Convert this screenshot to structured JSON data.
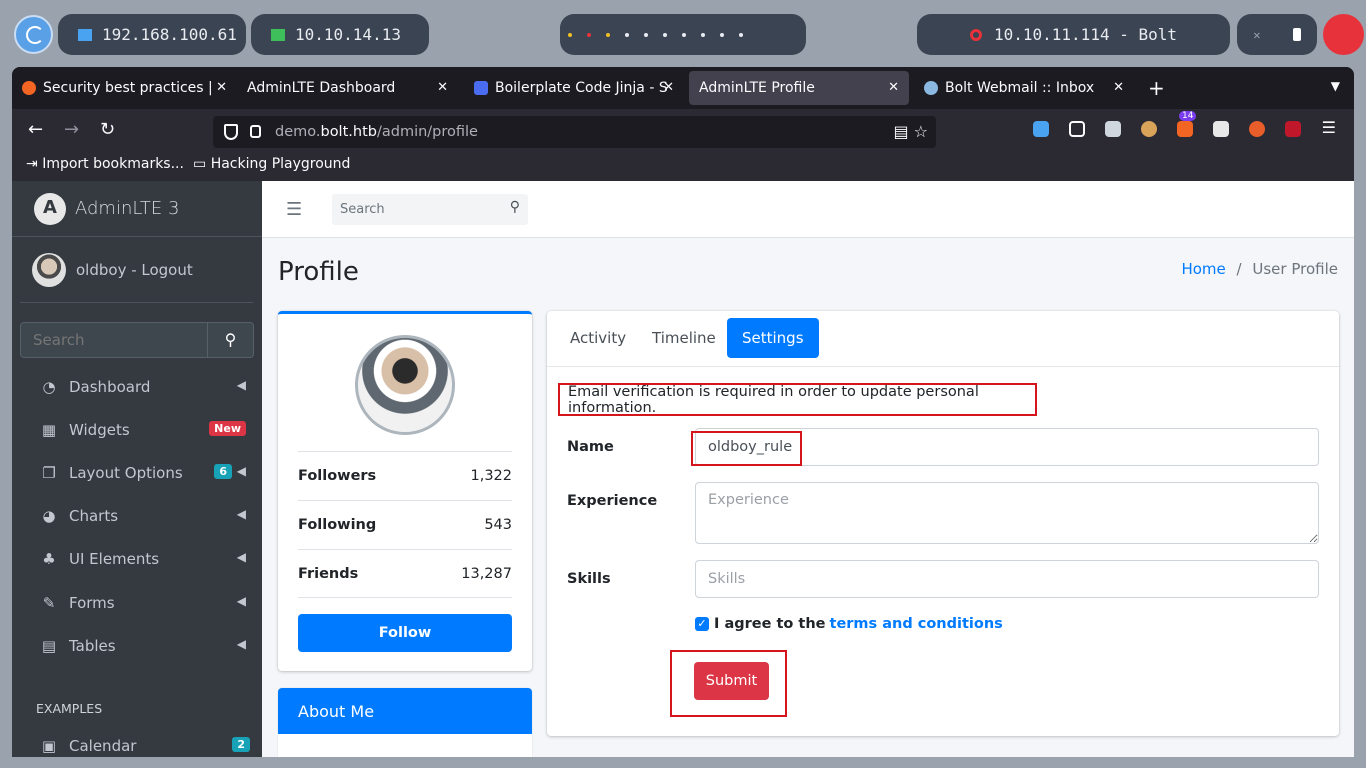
{
  "system_bar": {
    "ip_local": "192.168.100.61",
    "ip_vpn": "10.10.14.13",
    "target": "10.10.11.114 - Bolt"
  },
  "browser": {
    "tabs": [
      {
        "label": "Security best practices |"
      },
      {
        "label": "AdminLTE Dashboard"
      },
      {
        "label": "Boilerplate Code Jinja - S"
      },
      {
        "label": "AdminLTE Profile"
      },
      {
        "label": "Bolt Webmail :: Inbox"
      }
    ],
    "url_host_prefix": "demo.",
    "url_host_main": "bolt.htb",
    "url_path": "/admin/profile",
    "ext_badge": "14",
    "bookmarks": [
      {
        "label": "Import bookmarks..."
      },
      {
        "label": "Hacking Playground"
      }
    ]
  },
  "sidebar": {
    "brand": "AdminLTE 3",
    "user": "oldboy - Logout",
    "search_placeholder": "Search",
    "items": [
      {
        "label": "Dashboard"
      },
      {
        "label": "Widgets",
        "badge": "New"
      },
      {
        "label": "Layout Options",
        "badge": "6"
      },
      {
        "label": "Charts"
      },
      {
        "label": "UI Elements"
      },
      {
        "label": "Forms"
      },
      {
        "label": "Tables"
      }
    ],
    "header_examples": "EXAMPLES",
    "calendar": {
      "label": "Calendar",
      "badge": "2"
    }
  },
  "topnav": {
    "search_placeholder": "Search"
  },
  "content": {
    "title": "Profile",
    "breadcrumb_home": "Home",
    "breadcrumb_sep": "/",
    "breadcrumb_current": "User Profile"
  },
  "profile": {
    "stats": [
      {
        "label": "Followers",
        "value": "1,322"
      },
      {
        "label": "Following",
        "value": "543"
      },
      {
        "label": "Friends",
        "value": "13,287"
      }
    ],
    "follow_label": "Follow",
    "about_title": "About Me"
  },
  "settings": {
    "tabs": [
      {
        "label": "Activity"
      },
      {
        "label": "Timeline"
      },
      {
        "label": "Settings"
      }
    ],
    "alert": "Email verification is required in order to update personal information.",
    "name_label": "Name",
    "name_value": "oldboy_rule",
    "experience_label": "Experience",
    "experience_placeholder": "Experience",
    "skills_label": "Skills",
    "skills_placeholder": "Skills",
    "agree_text": "I agree to the",
    "terms_link": "terms and conditions",
    "submit_label": "Submit"
  },
  "colors": {
    "primary": "#007bff",
    "danger": "#dc3545",
    "sidebar_bg": "#343a40",
    "highlight": "#d4151c"
  }
}
